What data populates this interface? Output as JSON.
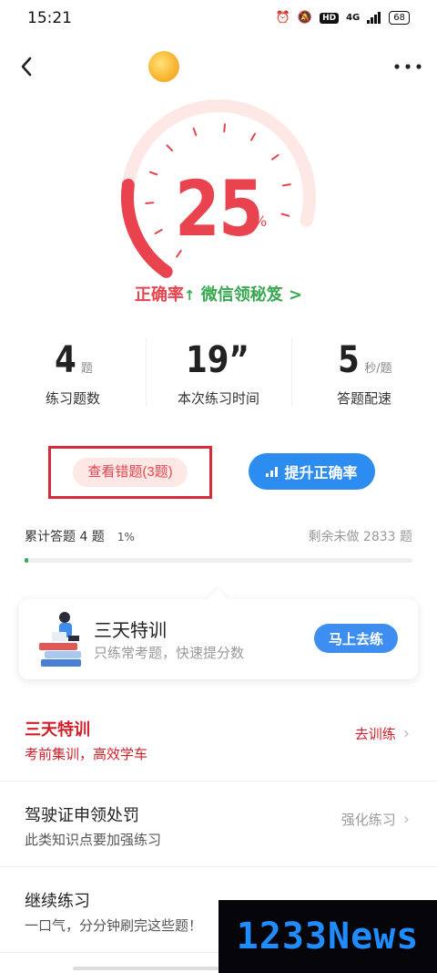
{
  "status_bar": {
    "time": "15:21",
    "hd": "HD",
    "network": "4G",
    "battery": "68"
  },
  "gauge": {
    "value": "25",
    "unit": "%",
    "level": 0.25
  },
  "accuracy": {
    "label": "正确率",
    "arrow": "↑",
    "link": "微信领秘笈",
    "link_chevron": ">"
  },
  "stats": [
    {
      "value": "4",
      "unit": "题",
      "label": "练习题数"
    },
    {
      "value": "19”",
      "unit": "",
      "label": "本次练习时间"
    },
    {
      "value": "5",
      "unit": "秒/题",
      "label": "答题配速"
    }
  ],
  "buttons": {
    "wrong": "查看错题(3题)",
    "boost": "提升正确率"
  },
  "progress": {
    "summary": "累计答题 4 题",
    "percent": "1%",
    "remaining": "剩余未做 2833 题",
    "fraction": 0.01
  },
  "training_card": {
    "title": "三天特训",
    "subtitle": "只练常考题，快速提分数",
    "button": "马上去练"
  },
  "list": [
    {
      "title": "三天特训",
      "subtitle": "考前集训，高效学车",
      "action": "去训练"
    },
    {
      "title": "驾驶证申领处罚",
      "subtitle": "此类知识点要加强练习",
      "action": "强化练习"
    },
    {
      "title": "继续练习",
      "subtitle": "一口气，分分钟刷完这些题！",
      "action": ""
    }
  ],
  "watermark": {
    "text": "1233News"
  },
  "colors": {
    "accent_red": "#e8434e",
    "accent_green": "#3aa853",
    "accent_blue": "#2d8cf0"
  }
}
